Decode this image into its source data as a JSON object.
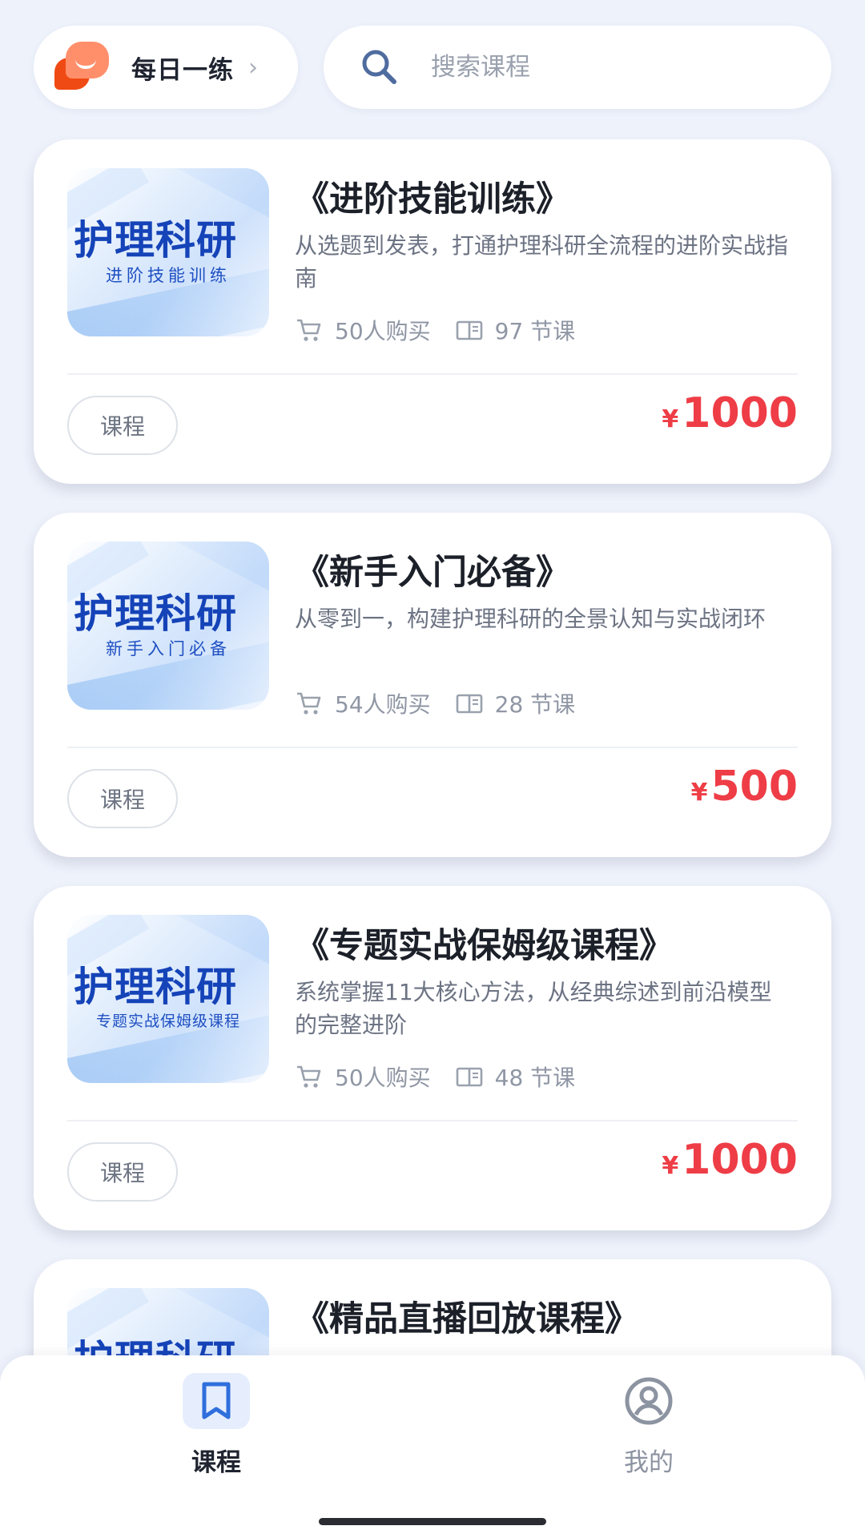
{
  "header": {
    "daily": {
      "label": "每日一练",
      "icon": "chat-bubbles-icon",
      "chevron": "chevron-right-icon"
    },
    "search": {
      "placeholder": "搜索课程",
      "icon": "search-icon"
    }
  },
  "courses": [
    {
      "thumb_title": "护理科研",
      "thumb_subtitle": "进阶技能训练",
      "title": "《进阶技能训练》",
      "description": "从选题到发表，打通护理科研全流程的进阶实战指南",
      "buyers": "50人购买",
      "lessons": "97 节课",
      "tag": "课程",
      "currency": "¥",
      "price": "1000"
    },
    {
      "thumb_title": "护理科研",
      "thumb_subtitle": "新手入门必备",
      "title": "《新手入门必备》",
      "description": "从零到一，构建护理科研的全景认知与实战闭环",
      "buyers": "54人购买",
      "lessons": "28 节课",
      "tag": "课程",
      "currency": "¥",
      "price": "500"
    },
    {
      "thumb_title": "护理科研",
      "thumb_subtitle": "专题实战保姆级课程",
      "title": "《专题实战保姆级课程》",
      "description": "系统掌握11大核心方法，从经典综述到前沿模型的完整进阶",
      "buyers": "50人购买",
      "lessons": "48 节课",
      "tag": "课程",
      "currency": "¥",
      "price": "1000"
    },
    {
      "thumb_title": "护理科研",
      "title": "《精品直播回放课程》"
    }
  ],
  "tabbar": {
    "items": [
      {
        "label": "课程",
        "icon": "bookmark-icon",
        "active": true
      },
      {
        "label": "我的",
        "icon": "user-circle-icon",
        "active": false
      }
    ]
  },
  "colors": {
    "background": "#eef2fb",
    "price": "#ee3d46",
    "thumb_title": "#1543b8",
    "accent": "#2f6fdc"
  }
}
